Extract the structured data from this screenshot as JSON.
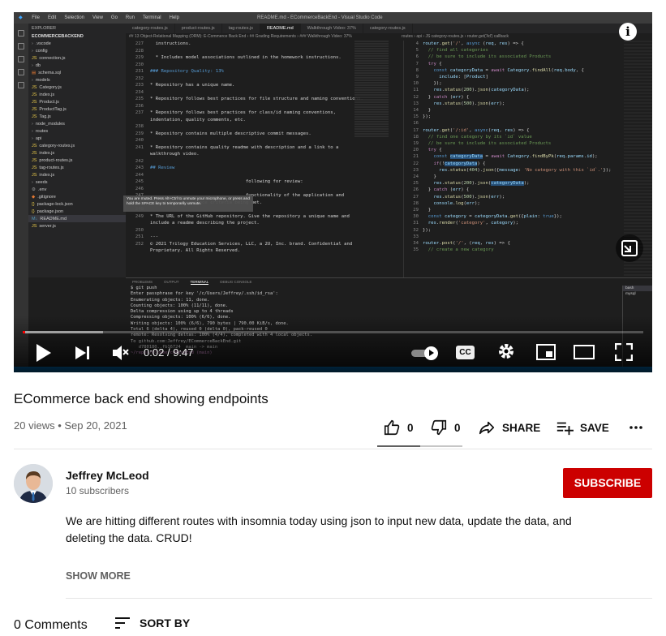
{
  "player": {
    "time_current": "0:02",
    "time_sep": "/",
    "time_total": "9:47",
    "progress_fraction": 0.004,
    "buffered_fraction": 0.13,
    "cc_label": "CC",
    "mute_tooltip": "You are muted. Press Alt+Ctrl to unmute your microphone, or press and hold the SPACE key to temporarily unmute."
  },
  "editor": {
    "menu": [
      "File",
      "Edit",
      "Selection",
      "View",
      "Go",
      "Run",
      "Terminal",
      "Help"
    ],
    "window_title": "README.md - ECommerceBackEnd - Visual Studio Code",
    "tabs": [
      "category-routes.js",
      "product-routes.js",
      "tag-routes.js",
      "README.md",
      "Walkthrough Video: 37%",
      "category-routes.js"
    ],
    "active_tab": 3,
    "breadcrumb": "## 13 Object-Relational Mapping (ORM): E-Commerce Back End  ›  ## Grading Requirements  ›  ### Walkthrough Video: 37%",
    "breadcrumb2": "routes › api › JS category-routes.js › router.get('/id') callback",
    "explorer": {
      "header": "EXPLORER",
      "root": "ECOMMERCEBACKEND",
      "files": [
        {
          "name": ".vscode",
          "kind": "folder"
        },
        {
          "name": "config",
          "kind": "folder"
        },
        {
          "name": "connection.js",
          "kind": "js"
        },
        {
          "name": "db",
          "kind": "folder"
        },
        {
          "name": "schema.sql",
          "kind": "sql"
        },
        {
          "name": "models",
          "kind": "folder"
        },
        {
          "name": "Category.js",
          "kind": "js"
        },
        {
          "name": "index.js",
          "kind": "js"
        },
        {
          "name": "Product.js",
          "kind": "js"
        },
        {
          "name": "ProductTag.js",
          "kind": "js"
        },
        {
          "name": "Tag.js",
          "kind": "js"
        },
        {
          "name": "node_modules",
          "kind": "folder"
        },
        {
          "name": "routes",
          "kind": "folder"
        },
        {
          "name": "api",
          "kind": "folder"
        },
        {
          "name": "category-routes.js",
          "kind": "js"
        },
        {
          "name": "index.js",
          "kind": "js"
        },
        {
          "name": "product-routes.js",
          "kind": "js"
        },
        {
          "name": "tag-routes.js",
          "kind": "js"
        },
        {
          "name": "index.js",
          "kind": "js"
        },
        {
          "name": "seeds",
          "kind": "folder"
        },
        {
          "name": ".env",
          "kind": "env"
        },
        {
          "name": ".gitignore",
          "kind": "git"
        },
        {
          "name": "package-lock.json",
          "kind": "json"
        },
        {
          "name": "package.json",
          "kind": "json"
        },
        {
          "name": "README.md",
          "kind": "md"
        },
        {
          "name": "server.js",
          "kind": "js"
        }
      ]
    },
    "readme_lines": [
      {
        "n": "227",
        "t": "  instructions.",
        "c": ""
      },
      {
        "n": "228",
        "t": "",
        "c": ""
      },
      {
        "n": "229",
        "t": "  * Includes model associations outlined in the homework instructions.",
        "c": ""
      },
      {
        "n": "230",
        "t": "",
        "c": ""
      },
      {
        "n": "231",
        "t": "### Repository Quality: 13%",
        "c": "hh"
      },
      {
        "n": "232",
        "t": "",
        "c": ""
      },
      {
        "n": "233",
        "t": "* Repository has a unique name.",
        "c": ""
      },
      {
        "n": "234",
        "t": "",
        "c": ""
      },
      {
        "n": "235",
        "t": "* Repository follows best practices for file structure and naming conventions.",
        "c": ""
      },
      {
        "n": "236",
        "t": "",
        "c": ""
      },
      {
        "n": "237",
        "t": "* Repository follows best practices for class/id naming conventions,",
        "c": ""
      },
      {
        "n": "",
        "t": "indentation, quality comments, etc.",
        "c": ""
      },
      {
        "n": "238",
        "t": "",
        "c": ""
      },
      {
        "n": "239",
        "t": "* Repository contains multiple descriptive commit messages.",
        "c": ""
      },
      {
        "n": "240",
        "t": "",
        "c": ""
      },
      {
        "n": "241",
        "t": "* Repository contains quality readme with description and a link to a",
        "c": ""
      },
      {
        "n": "",
        "t": "walkthrough video.",
        "c": ""
      },
      {
        "n": "242",
        "t": "",
        "c": ""
      },
      {
        "n": "243",
        "t": "## Review",
        "c": "hh"
      },
      {
        "n": "244",
        "t": "",
        "c": ""
      },
      {
        "n": "245",
        "t": "                                   following for review:",
        "c": ""
      },
      {
        "n": "246",
        "t": "",
        "c": ""
      },
      {
        "n": "247",
        "t": "                                   functionality of the application and",
        "c": ""
      },
      {
        "n": "",
        "t": "all of the acceptance criteria being met.",
        "c": ""
      },
      {
        "n": "248",
        "t": "",
        "c": ""
      },
      {
        "n": "249",
        "t": "* The URL of the GitHub repository. Give the repository a unique name and",
        "c": ""
      },
      {
        "n": "",
        "t": "include a readme describing the project.",
        "c": ""
      },
      {
        "n": "250",
        "t": "",
        "c": ""
      },
      {
        "n": "251",
        "t": "---",
        "c": ""
      },
      {
        "n": "252",
        "t": "© 2021 Trilogy Education Services, LLC, a 2U, Inc. brand. Confidential and",
        "c": ""
      },
      {
        "n": "",
        "t": "Proprietary. All Rights Reserved.",
        "c": ""
      }
    ],
    "code_lines": [
      {
        "n": "4",
        "h": "<span class=\"vr\">router</span>.<span class=\"fn\">get</span>(<span class=\"st\">'/'</span>, <span class=\"kw\">async</span> (<span class=\"vr\">req</span>, <span class=\"vr\">res</span>) => {"
      },
      {
        "n": "5",
        "h": "  <span class=\"cm\">// find all categories</span>"
      },
      {
        "n": "6",
        "h": "  <span class=\"cm\">// be sure to include its associated Products</span>"
      },
      {
        "n": "7",
        "h": "  <span class=\"ctl\">try</span> {"
      },
      {
        "n": "8",
        "h": "    <span class=\"kw\">const</span> <span class=\"vr\">categoryData</span> = <span class=\"ctl\">await</span> <span class=\"vr\">Category</span>.<span class=\"fn\">findAll</span>(<span class=\"vr\">req</span>.<span class=\"vr\">body</span>, {"
      },
      {
        "n": "9",
        "h": "      <span class=\"vr\">include</span>: [<span class=\"vr\">Product</span>]"
      },
      {
        "n": "10",
        "h": "    });"
      },
      {
        "n": "11",
        "h": "    <span class=\"vr\">res</span>.<span class=\"fn\">status</span>(<span class=\"nb\">200</span>).<span class=\"fn\">json</span>(<span class=\"vr\">categoryData</span>);"
      },
      {
        "n": "12",
        "h": "  } <span class=\"ctl\">catch</span> (<span class=\"vr\">err</span>) {"
      },
      {
        "n": "13",
        "h": "    <span class=\"vr\">res</span>.<span class=\"fn\">status</span>(<span class=\"nb\">500</span>).<span class=\"fn\">json</span>(<span class=\"vr\">err</span>);"
      },
      {
        "n": "14",
        "h": "  }"
      },
      {
        "n": "15",
        "h": "});"
      },
      {
        "n": "16",
        "h": ""
      },
      {
        "n": "17",
        "h": "<span class=\"vr\">router</span>.<span class=\"fn\">get</span>(<span class=\"st\">'/:id'</span>, <span class=\"kw\">async</span>(<span class=\"vr\">req</span>, <span class=\"vr\">res</span>) => {"
      },
      {
        "n": "18",
        "h": "  <span class=\"cm\">// find one category by its `id` value</span>"
      },
      {
        "n": "19",
        "h": "  <span class=\"cm\">// be sure to include its associated Products</span>"
      },
      {
        "n": "20",
        "h": "  <span class=\"ctl\">try</span> {"
      },
      {
        "n": "21",
        "h": "    <span class=\"kw\">const</span> <span class=\"vr hl\">categoryData</span> = <span class=\"ctl\">await</span> <span class=\"vr\">Category</span>.<span class=\"fn\">findByPk</span>(<span class=\"vr\">req</span>.<span class=\"vr\">params</span>.<span class=\"vr\">id</span>);"
      },
      {
        "n": "22",
        "h": "    <span class=\"ctl\">if</span>(!<span class=\"vr hl\">categoryData</span>) {"
      },
      {
        "n": "23",
        "h": "      <span class=\"vr\">res</span>.<span class=\"fn\">status</span>(<span class=\"nb\">404</span>).<span class=\"fn\">json</span>({<span class=\"vr\">message</span>: <span class=\"st\">'No category with this `id`.'</span>});"
      },
      {
        "n": "24",
        "h": "    }"
      },
      {
        "n": "25",
        "h": "    <span class=\"vr\">res</span>.<span class=\"fn\">status</span>(<span class=\"nb\">200</span>).<span class=\"fn\">json</span>(<span class=\"vr hl\">categoryData</span>);"
      },
      {
        "n": "26",
        "h": "  } <span class=\"ctl\">catch</span> (<span class=\"vr\">err</span>) {"
      },
      {
        "n": "27",
        "h": "    <span class=\"vr\">res</span>.<span class=\"fn\">status</span>(<span class=\"nb\">500</span>).<span class=\"fn\">json</span>(<span class=\"vr\">err</span>);"
      },
      {
        "n": "28",
        "h": "    <span class=\"vr\">console</span>.<span class=\"fn\">log</span>(<span class=\"vr\">err</span>);"
      },
      {
        "n": "29",
        "h": "  }"
      },
      {
        "n": "30",
        "h": "  <span class=\"kw\">const</span> <span class=\"vr\">category</span> = <span class=\"vr\">categoryData</span>.<span class=\"fn\">get</span>({<span class=\"vr\">plain</span>: <span class=\"kw\">true</span>});"
      },
      {
        "n": "31",
        "h": "  <span class=\"vr\">res</span>.<span class=\"fn\">render</span>(<span class=\"st\">'category'</span>, <span class=\"vr\">category</span>);"
      },
      {
        "n": "32",
        "h": "});"
      },
      {
        "n": "33",
        "h": ""
      },
      {
        "n": "34",
        "h": "<span class=\"vr\">router</span>.<span class=\"fn\">post</span>(<span class=\"st\">'/'</span>, (<span class=\"vr\">req</span>, <span class=\"vr\">res</span>) => {"
      },
      {
        "n": "35",
        "h": "  <span class=\"cm\">// create a new category</span>"
      }
    ],
    "terminal_tabs": [
      "PROBLEMS",
      "OUTPUT",
      "TERMINAL",
      "DEBUG CONSOLE"
    ],
    "terminal_active": 2,
    "terminal_lines": [
      "$ git push",
      "Enter passphrase for key '/c/Users/Jeffrey/.ssh/id_rsa':",
      "Enumerating objects: 11, done.",
      "Counting objects: 100% (11/11), done.",
      "Delta compression using up to 4 threads",
      "Compressing objects: 100% (6/6), done.",
      "Writing objects: 100% (6/6), 790 bytes | 790.00 KiB/s, done.",
      "Total 6 (delta 4), reused 0 (delta 0), pack-reused 0",
      "remote: Resolving deltas: 100% (4/4), completed with 4 local objects.",
      "To github.com:Jeffrey/ECommerceBackEnd.git",
      "   d780180..fb16724  main -> main"
    ],
    "terminal_prompt": "~/repos/ECommerceBackEnd (main)",
    "terminal_shells": [
      "bash",
      "mysql"
    ]
  },
  "video": {
    "title": "ECommerce back end showing endpoints",
    "views": "20 views",
    "date": "Sep 20, 2021",
    "likes": "0",
    "dislikes": "0",
    "share_label": "SHARE",
    "save_label": "SAVE"
  },
  "channel": {
    "name": "Jeffrey McLeod",
    "subscribers": "10 subscribers",
    "subscribe_label": "SUBSCRIBE"
  },
  "description": {
    "text": "We are hitting different routes with insomnia today using json to input new data, update the data, and deleting the data. CRUD!",
    "show_more_label": "SHOW MORE"
  },
  "comments": {
    "count_label": "0 Comments",
    "sort_label": "SORT BY"
  },
  "colors": {
    "subscribe": "#cc0000",
    "progress": "#ff0000",
    "vscode_status": "#007acc"
  }
}
